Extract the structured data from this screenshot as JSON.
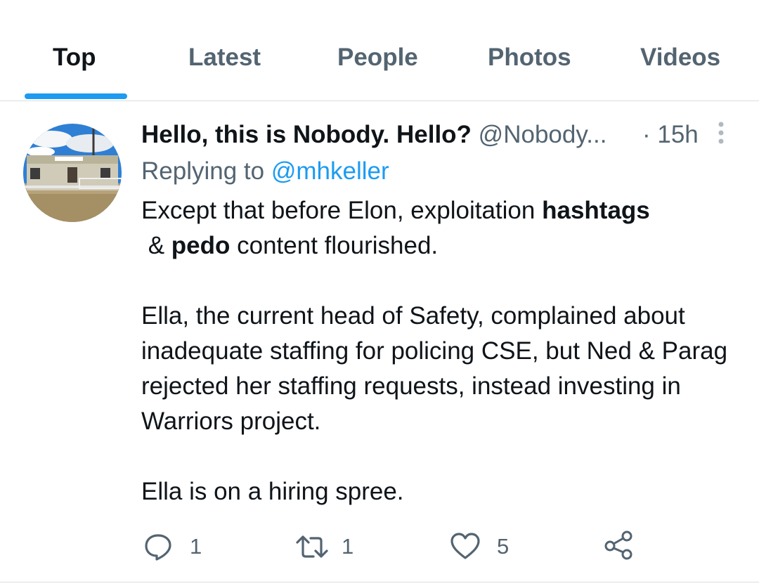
{
  "tabs": [
    {
      "label": "Top",
      "active": true
    },
    {
      "label": "Latest",
      "active": false
    },
    {
      "label": "People",
      "active": false
    },
    {
      "label": "Photos",
      "active": false
    },
    {
      "label": "Videos",
      "active": false
    }
  ],
  "accent_color": "#1d9bf0",
  "tweet": {
    "display_name": "Hello, this is Nobody. Hello?",
    "handle": "@Nobody...",
    "timestamp": "· 15h",
    "replying_prefix": "Replying to ",
    "replying_to": "@mhkeller",
    "body": {
      "p1_a": "Except that before Elon, exploitation ",
      "p1_b": "hashtags",
      "p1_c": " & ",
      "p1_d": "pedo",
      "p1_e": " content flourished.",
      "p2": "Ella, the current head of Safety, complained about inadequate staffing for policing CSE, but Ned & Parag rejected her staffing requests, instead investing in Warriors project.",
      "p3": "Ella is on a hiring spree."
    },
    "actions": {
      "reply_count": "1",
      "retweet_count": "1",
      "like_count": "5"
    },
    "icons": {
      "avatar": "avatar-building-photo",
      "more": "more-vertical-icon",
      "reply": "reply-bubble-icon",
      "retweet": "retweet-icon",
      "like": "heart-icon",
      "share": "share-icon"
    }
  }
}
